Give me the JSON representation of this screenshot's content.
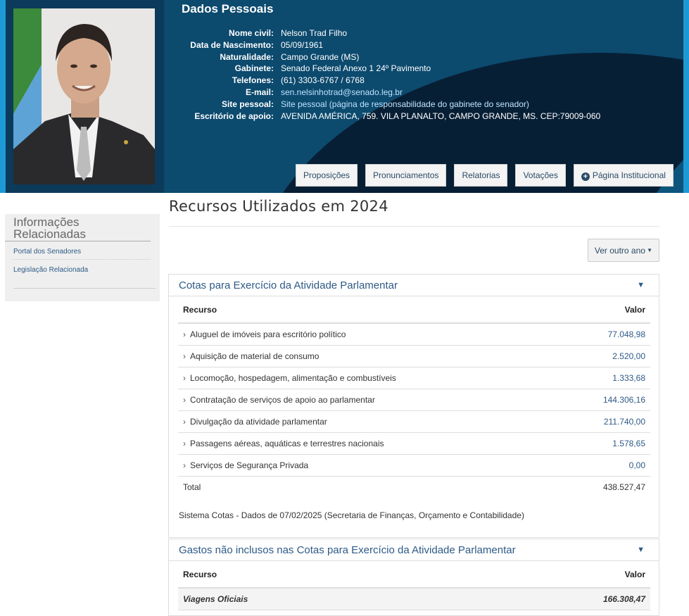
{
  "header": {
    "title": "Dados Pessoais",
    "fields": [
      {
        "label": "Nome civil:",
        "value": "Nelson Trad Filho",
        "link": false
      },
      {
        "label": "Data de Nascimento:",
        "value": "05/09/1961",
        "link": false
      },
      {
        "label": "Naturalidade:",
        "value": "Campo Grande (MS)",
        "link": false
      },
      {
        "label": "Gabinete:",
        "value": "Senado Federal Anexo 1 24º Pavimento",
        "link": false
      },
      {
        "label": "Telefones:",
        "value": "(61) 3303-6767 / 6768",
        "link": false
      },
      {
        "label": "E-mail:",
        "value": "sen.nelsinhotrad@senado.leg.br",
        "link": true
      },
      {
        "label": "Site pessoal:",
        "value": "Site pessoal (página de responsabilidade do gabinete do senador)",
        "link": true
      },
      {
        "label": "Escritório de apoio:",
        "value": "AVENIDA AMÉRICA, 759. VILA PLANALTO, CAMPO GRANDE, MS. CEP:79009-060",
        "link": false
      }
    ],
    "nav": [
      "Proposições",
      "Pronunciamentos",
      "Relatorias",
      "Votações",
      "Página Institucional"
    ]
  },
  "sidebar": {
    "title": "Informações Relacionadas",
    "links": [
      "Portal dos Senadores",
      "Legislação Relacionada"
    ]
  },
  "main": {
    "title": "Recursos Utilizados em 2024",
    "year_button": "Ver outro ano",
    "cotas": {
      "title": "Cotas para Exercício da Atividade Parlamentar",
      "col_resource": "Recurso",
      "col_value": "Valor",
      "rows": [
        {
          "label": "Aluguel de imóveis para escritório político",
          "value": "77.048,98"
        },
        {
          "label": "Aquisição de material de consumo",
          "value": "2.520,00"
        },
        {
          "label": "Locomoção, hospedagem, alimentação e combustíveis",
          "value": "1.333,68"
        },
        {
          "label": "Contratação de serviços de apoio ao parlamentar",
          "value": "144.306,16"
        },
        {
          "label": "Divulgação da atividade parlamentar",
          "value": "211.740,00"
        },
        {
          "label": "Passagens aéreas, aquáticas e terrestres nacionais",
          "value": "1.578,65"
        },
        {
          "label": "Serviços de Segurança Privada",
          "value": "0,00"
        }
      ],
      "total_label": "Total",
      "total_value": "438.527,47",
      "note": "Sistema Cotas - Dados de 07/02/2025 (Secretaria de Finanças, Orçamento e Contabilidade)"
    },
    "gastos": {
      "title": "Gastos não inclusos nas Cotas para Exercício da Atividade Parlamentar",
      "col_resource": "Recurso",
      "col_value": "Valor",
      "rows": [
        {
          "label": "Viagens Oficiais",
          "value": "166.308,47"
        }
      ]
    }
  },
  "colors": {
    "header_bg": "#0c4a6e",
    "edge_accent": "#1d9ad6",
    "link": "#2e5a86"
  }
}
